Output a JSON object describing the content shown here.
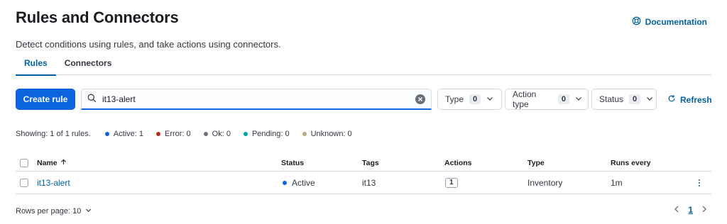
{
  "header": {
    "title": "Rules and Connectors",
    "subtitle": "Detect conditions using rules, and take actions using connectors.",
    "documentation_label": "Documentation"
  },
  "tabs": [
    {
      "label": "Rules",
      "active": true
    },
    {
      "label": "Connectors",
      "active": false
    }
  ],
  "toolbar": {
    "create_label": "Create rule",
    "search_value": "it13-alert",
    "filters": [
      {
        "label": "Type",
        "count": "0"
      },
      {
        "label": "Action type",
        "count": "0"
      },
      {
        "label": "Status",
        "count": "0"
      }
    ],
    "refresh_label": "Refresh"
  },
  "stats": {
    "showing": "Showing: 1 of 1 rules.",
    "items": [
      {
        "label": "Active: 1",
        "color": "#0b64dd"
      },
      {
        "label": "Error: 0",
        "color": "#bd271e"
      },
      {
        "label": "Ok: 0",
        "color": "#69707d"
      },
      {
        "label": "Pending: 0",
        "color": "#00a69b"
      },
      {
        "label": "Unknown: 0",
        "color": "#b9a888"
      }
    ]
  },
  "table": {
    "columns": {
      "name": "Name",
      "status": "Status",
      "tags": "Tags",
      "actions": "Actions",
      "type": "Type",
      "runs_every": "Runs every"
    },
    "rows": [
      {
        "name": "it13-alert",
        "status": "Active",
        "status_color": "#0b64dd",
        "tags": "it13",
        "actions": "1",
        "type": "Inventory",
        "runs_every": "1m"
      }
    ]
  },
  "footer": {
    "rows_per_page": "Rows per page: 10",
    "current_page": "1"
  },
  "icons": {
    "documentation": "help-circle-icon",
    "search": "search-icon",
    "clear": "clear-icon",
    "refresh": "refresh-icon",
    "sort": "arrow-up-icon",
    "chevron": "chevron-down-icon"
  }
}
